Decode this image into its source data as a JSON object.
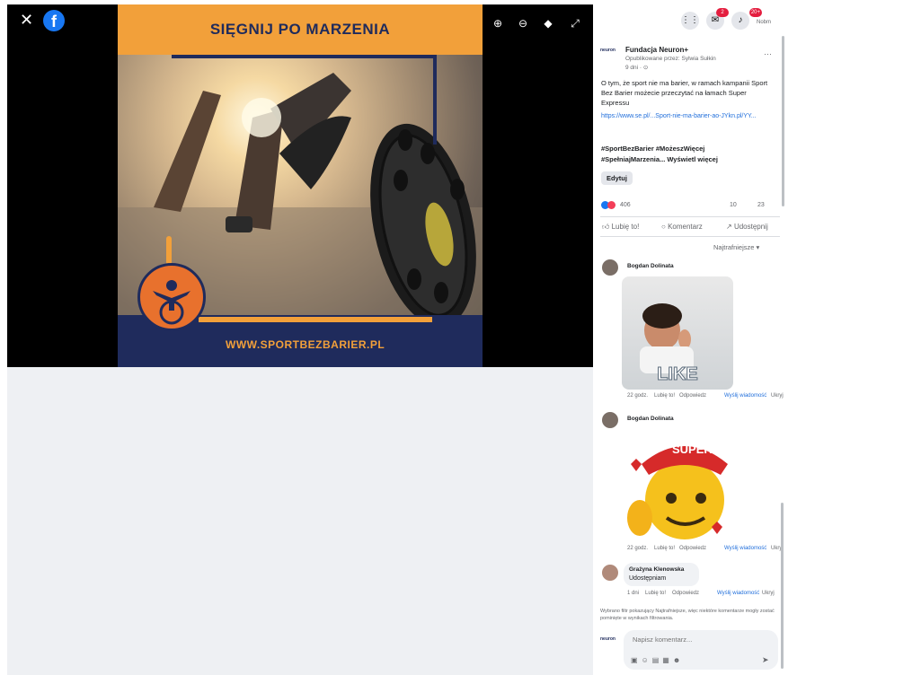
{
  "viewer": {
    "close_glyph": "✕",
    "logo_letter": "f",
    "tools": [
      {
        "name": "zoom-in-icon",
        "glyph": "⊕"
      },
      {
        "name": "zoom-out-icon",
        "glyph": "⊖"
      },
      {
        "name": "tag-icon",
        "glyph": "◆"
      },
      {
        "name": "fullscreen-icon",
        "glyph": "⤢"
      }
    ],
    "poster": {
      "title": "SIĘGNIJ PO MARZENIA",
      "url": "WWW.SPORTBEZBARIER.PL",
      "colors": {
        "orange": "#f2a03a",
        "navy": "#1f2b5c"
      }
    }
  },
  "panel": {
    "top_icons": {
      "menu_glyph": "⋮⋮",
      "messenger_badge": "2",
      "notifications_badge": "20+",
      "profile_name": "Nobm"
    },
    "post": {
      "author": "Fundacja Neuron+",
      "published_by": "Opublikowane przez: Sylwia Sułkin",
      "time": "9 dni · ⊙",
      "more": "···",
      "body": "O tym, że sport nie ma barier, w ramach kampanii Sport Bez Barier możecie przeczytać na łamach Super Expressu",
      "link": "https://www.se.pl/...Sport-nie-ma-barier-ao-JYkn.pl/YY...",
      "hashtags_1": "#SportBezBarier #MożeszWięcej",
      "hashtags_2": "#SpełniajMarzenia... Wyświetl więcej",
      "edit_button": "Edytuj",
      "reaction_count": "406",
      "comment_count": "10",
      "share_count": "23"
    },
    "actions": {
      "like": "Lubię to!",
      "comment": "Komentarz",
      "share": "Udostępnij"
    },
    "sort_label": "Najtrafniejsze ▾",
    "comments": [
      {
        "author": "Bogdan Dolinata",
        "gif_caption": "LIKE",
        "time": "22 godz.",
        "like": "Lubię to!",
        "reply": "Odpowiedz",
        "translate": "Wyślij wiadomość",
        "hide": "Ukryj"
      },
      {
        "author": "Bogdan Dolinata",
        "gif_caption": "SUPER",
        "time": "22 godz.",
        "like": "Lubię to!",
        "reply": "Odpowiedz",
        "translate": "Wyślij wiadomość",
        "hide": "Ukryj"
      },
      {
        "author": "Grażyna Klenowska",
        "text": "Udostępniam",
        "time": "1 dni",
        "like": "Lubię to!",
        "reply": "Odpowiedz",
        "translate": "Wyślij wiadomość",
        "hide": "Ukryj"
      }
    ],
    "filter_note": "Wybrano filtr pokazujący Najtrafniejsze, więc niektóre komentarze mogły zostać pominięte w wynikach filtrowania.",
    "composer": {
      "placeholder": "Napisz komentarz...",
      "icons": [
        "camera-icon",
        "emoji-icon",
        "gif-icon",
        "sticker-icon",
        "smile-icon"
      ],
      "send_glyph": "➤"
    }
  }
}
